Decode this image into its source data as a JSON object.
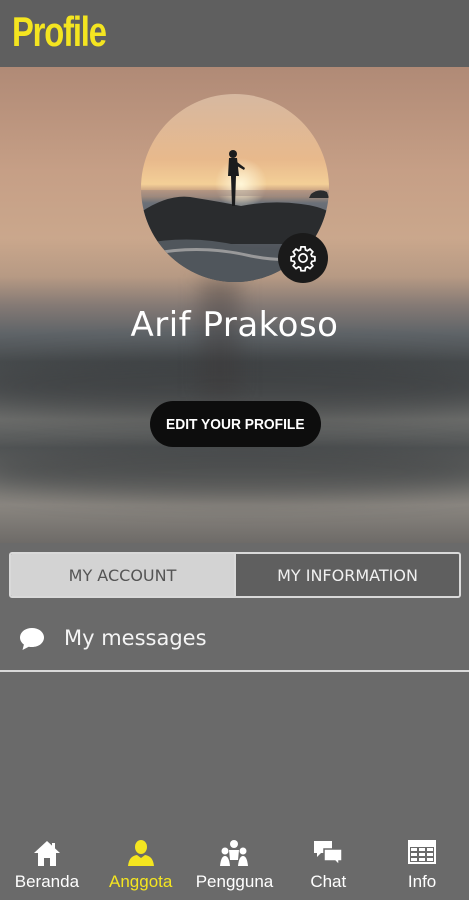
{
  "header": {
    "title": "Profile"
  },
  "profile": {
    "name": "Arif Prakoso",
    "edit_button_label": "EDIT YOUR PROFILE"
  },
  "tabs": [
    {
      "label": "MY ACCOUNT",
      "active": true
    },
    {
      "label": "MY INFORMATION",
      "active": false
    }
  ],
  "menu": {
    "messages_label": "My messages",
    "messages_icon": "speech-bubble-icon"
  },
  "bottom_nav": [
    {
      "label": "Beranda",
      "icon": "home-icon",
      "active": false
    },
    {
      "label": "Anggota",
      "icon": "person-icon",
      "active": true
    },
    {
      "label": "Pengguna",
      "icon": "users-icon",
      "active": false
    },
    {
      "label": "Chat",
      "icon": "chat-icon",
      "active": false
    },
    {
      "label": "Info",
      "icon": "calendar-icon",
      "active": false
    }
  ],
  "colors": {
    "accent": "#f4e520",
    "header_bg": "#5f5f5f",
    "page_bg": "#6a6a6a"
  }
}
